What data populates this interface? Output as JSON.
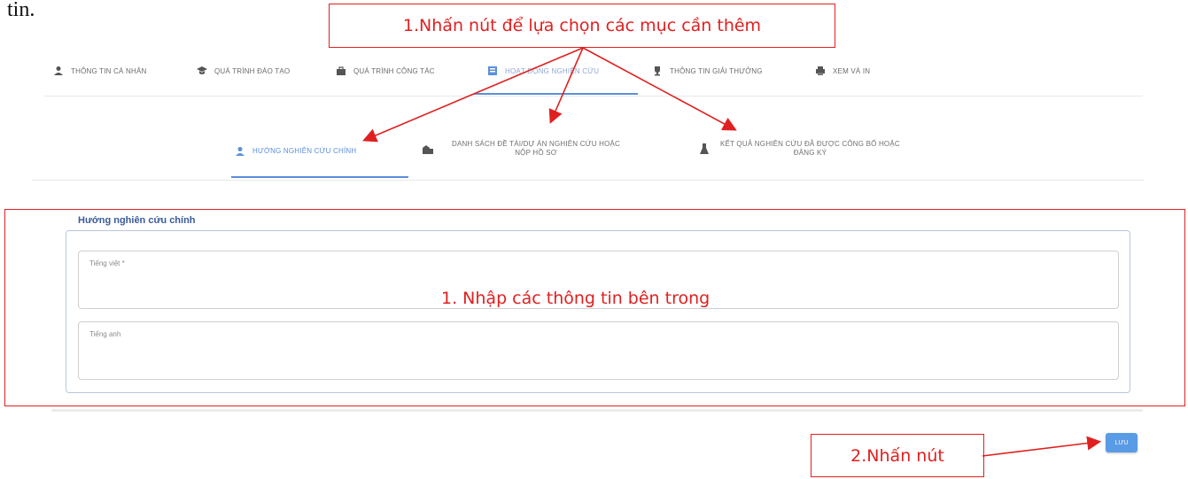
{
  "doc_fragment": "tin.",
  "top_tabs": [
    {
      "label": "THÔNG TIN CÁ NHÂN",
      "icon": "user-icon"
    },
    {
      "label": "QUÁ TRÌNH ĐÀO TẠO",
      "icon": "graduation-cap-icon"
    },
    {
      "label": "QUÁ TRÌNH CÔNG TÁC",
      "icon": "briefcase-icon"
    },
    {
      "label": "HOẠT ĐỘNG NGHIÊN CỨU",
      "icon": "book-icon",
      "active": true
    },
    {
      "label": "THÔNG TIN GIẢI THƯỞNG",
      "icon": "trophy-icon"
    },
    {
      "label": "XEM VÀ IN",
      "icon": "printer-icon"
    }
  ],
  "sub_tabs": [
    {
      "label": "HƯỚNG NGHIÊN CỨU CHÍNH",
      "icon": "user-icon",
      "active": true
    },
    {
      "label_line1": "DANH SÁCH ĐỀ TÀI/DỰ ÁN NGHIÊN CỨU HOẶC",
      "label_line2": "NỘP HỒ SƠ",
      "icon": "building-icon"
    },
    {
      "label_line1": "KẾT QUẢ NGHIÊN CỨU ĐÃ ĐƯỢC CÔNG BỐ HOẶC",
      "label_line2": "ĐĂNG KÝ",
      "icon": "flask-icon"
    }
  ],
  "form": {
    "legend": "Hướng nghiên cứu chính",
    "fields": [
      {
        "label": "Tiếng việt *",
        "value": ""
      },
      {
        "label": "Tiếng anh",
        "value": ""
      }
    ],
    "save_label": "LƯU"
  },
  "annotations": {
    "select_note": "1.Nhấn nút để lựa chọn các mục cần thêm",
    "input_note": "1. Nhập các thông tin bên trong",
    "click_note": "2.Nhấn nút"
  },
  "colors": {
    "accent": "#5a8fdc",
    "annotation": "#e02020",
    "legend": "#3a5a9a"
  }
}
